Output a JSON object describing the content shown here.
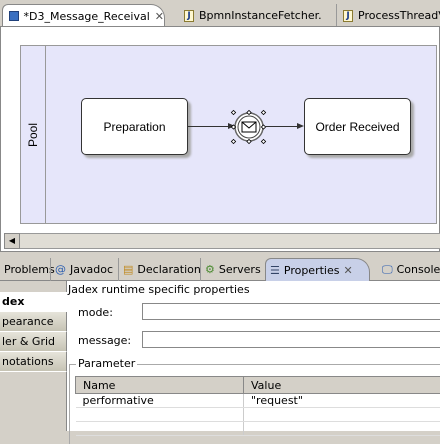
{
  "editor_tabs": [
    {
      "label": "*D3_Message_Receival",
      "icon": "diagram-icon",
      "active": true
    },
    {
      "label": "BpmnInstanceFetcher.",
      "icon": "java-file-icon"
    },
    {
      "label": "ProcessThreadVa",
      "icon": "java-file-icon"
    }
  ],
  "diagram": {
    "pool_label": "Pool",
    "tasks": [
      "Preparation",
      "Order Received"
    ],
    "event": "message-intermediate-event"
  },
  "view_tabs": [
    "Problems",
    "Javadoc",
    "Declaration",
    "Servers",
    "Properties",
    "Console"
  ],
  "properties": {
    "section_tabs": [
      "dex",
      "pearance",
      "ler & Grid",
      "notations"
    ],
    "title": "Jadex runtime specific properties",
    "mode_label": "mode:",
    "mode_value": "",
    "message_label": "message:",
    "message_value": "",
    "group_label": "Parameter",
    "table": {
      "columns": [
        "Name",
        "Value"
      ],
      "rows": [
        [
          "performative",
          "\"request\""
        ]
      ]
    }
  }
}
